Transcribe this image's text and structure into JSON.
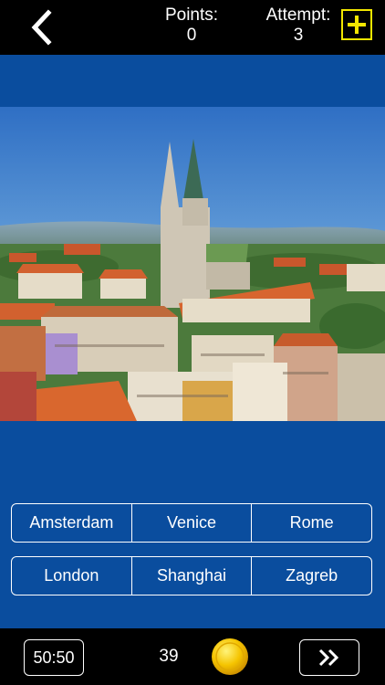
{
  "header": {
    "back_icon": "chevron-left-icon",
    "points_label": "Points:",
    "points_value": "0",
    "attempt_label": "Attempt:",
    "attempt_value": "3",
    "add_icon": "plus-icon",
    "accent_color": "#f2e600"
  },
  "answers": {
    "row1": [
      "Amsterdam",
      "Venice",
      "Rome"
    ],
    "row2": [
      "London",
      "Shanghai",
      "Zagreb"
    ]
  },
  "footer": {
    "fifty_fifty_label": "50:50",
    "coins": "39",
    "coin_icon": "gold-coin-icon",
    "next_icon": "double-chevron-right-icon"
  },
  "colors": {
    "background": "#0a4d9e",
    "bars": "#000000"
  }
}
